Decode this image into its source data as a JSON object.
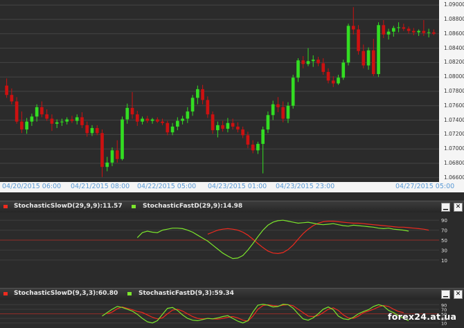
{
  "chart_data": [
    {
      "type": "candlestick",
      "bullish_color": "#33dd22",
      "bearish_color": "#cc1111",
      "ylim": [
        1.0655,
        1.0905
      ],
      "y_ticks": [
        "1.09000",
        "1.08800",
        "1.08600",
        "1.08400",
        "1.08200",
        "1.08000",
        "1.07800",
        "1.07600",
        "1.07400",
        "1.07200",
        "1.07000",
        "1.06800",
        "1.06600"
      ],
      "x_labels": [
        "04/20/2015 06:00",
        "04/21/2015 08:00",
        "04/22/2015 05:00",
        "04/23/2015 01:00",
        "04/23/2015 23:00",
        "04/27/2015 05:00"
      ],
      "ohlc": [
        [
          1.0788,
          1.0798,
          1.0771,
          1.0775
        ],
        [
          1.0775,
          1.0784,
          1.0762,
          1.0766
        ],
        [
          1.0766,
          1.0772,
          1.0735,
          1.0738
        ],
        [
          1.0738,
          1.0752,
          1.0722,
          1.0727
        ],
        [
          1.0727,
          1.0743,
          1.0721,
          1.0738
        ],
        [
          1.0738,
          1.0749,
          1.0732,
          1.0745
        ],
        [
          1.0745,
          1.0762,
          1.0738,
          1.0758
        ],
        [
          1.0758,
          1.0766,
          1.0744,
          1.0748
        ],
        [
          1.0748,
          1.0755,
          1.0739,
          1.0742
        ],
        [
          1.0742,
          1.0748,
          1.0725,
          1.0735
        ],
        [
          1.0735,
          1.0741,
          1.0729,
          1.0737
        ],
        [
          1.0737,
          1.0742,
          1.0732,
          1.0738
        ],
        [
          1.0738,
          1.0744,
          1.0734,
          1.0741
        ],
        [
          1.0741,
          1.0746,
          1.0736,
          1.0739
        ],
        [
          1.0739,
          1.0748,
          1.0734,
          1.0744
        ],
        [
          1.0744,
          1.0751,
          1.0729,
          1.0733
        ],
        [
          1.0733,
          1.0738,
          1.0717,
          1.0722
        ],
        [
          1.0722,
          1.0733,
          1.0718,
          1.0729
        ],
        [
          1.0729,
          1.0733,
          1.0719,
          1.0722
        ],
        [
          1.0722,
          1.0727,
          1.0661,
          1.0675
        ],
        [
          1.0675,
          1.0689,
          1.0669,
          1.0681
        ],
        [
          1.0681,
          1.0702,
          1.0676,
          1.0698
        ],
        [
          1.0698,
          1.0712,
          1.0681,
          1.0686
        ],
        [
          1.0686,
          1.0745,
          1.0684,
          1.0741
        ],
        [
          1.0741,
          1.0763,
          1.0735,
          1.0757
        ],
        [
          1.0757,
          1.0779,
          1.0742,
          1.0748
        ],
        [
          1.0748,
          1.0753,
          1.0732,
          1.0738
        ],
        [
          1.0738,
          1.0745,
          1.0734,
          1.0742
        ],
        [
          1.0742,
          1.0746,
          1.0736,
          1.0739
        ],
        [
          1.0739,
          1.0743,
          1.0735,
          1.0741
        ],
        [
          1.0741,
          1.0744,
          1.0736,
          1.0738
        ],
        [
          1.0738,
          1.0742,
          1.0733,
          1.0736
        ],
        [
          1.0736,
          1.0739,
          1.0719,
          1.0723
        ],
        [
          1.0723,
          1.0736,
          1.0719,
          1.0731
        ],
        [
          1.0731,
          1.0744,
          1.0726,
          1.0739
        ],
        [
          1.0739,
          1.0746,
          1.0734,
          1.0742
        ],
        [
          1.0742,
          1.0758,
          1.0736,
          1.0752
        ],
        [
          1.0752,
          1.0775,
          1.0746,
          1.0771
        ],
        [
          1.0771,
          1.0788,
          1.0762,
          1.0783
        ],
        [
          1.0783,
          1.0789,
          1.0762,
          1.0768
        ],
        [
          1.0768,
          1.0773,
          1.0743,
          1.0748
        ],
        [
          1.0748,
          1.0752,
          1.0721,
          1.0726
        ],
        [
          1.0726,
          1.0738,
          1.0716,
          1.0733
        ],
        [
          1.0733,
          1.0739,
          1.0724,
          1.0728
        ],
        [
          1.0728,
          1.0743,
          1.0723,
          1.0736
        ],
        [
          1.0736,
          1.0742,
          1.0727,
          1.0731
        ],
        [
          1.0731,
          1.0737,
          1.0723,
          1.0727
        ],
        [
          1.0727,
          1.0731,
          1.0715,
          1.0719
        ],
        [
          1.0719,
          1.0724,
          1.0701,
          1.0706
        ],
        [
          1.0706,
          1.0712,
          1.0694,
          1.0698
        ],
        [
          1.0698,
          1.071,
          1.0693,
          1.0707
        ],
        [
          1.0707,
          1.0731,
          1.0666,
          1.0727
        ],
        [
          1.0727,
          1.0752,
          1.0722,
          1.0747
        ],
        [
          1.0747,
          1.0767,
          1.074,
          1.0762
        ],
        [
          1.0762,
          1.0772,
          1.0751,
          1.0758
        ],
        [
          1.0758,
          1.0766,
          1.0737,
          1.0742
        ],
        [
          1.0742,
          1.0765,
          1.0736,
          1.076
        ],
        [
          1.076,
          1.0803,
          1.0756,
          1.0799
        ],
        [
          1.0799,
          1.0826,
          1.0793,
          1.0823
        ],
        [
          1.0823,
          1.0829,
          1.0812,
          1.0818
        ],
        [
          1.0818,
          1.084,
          1.0815,
          1.0822
        ],
        [
          1.0822,
          1.083,
          1.0814,
          1.0824
        ],
        [
          1.0824,
          1.0828,
          1.0815,
          1.0819
        ],
        [
          1.0819,
          1.0826,
          1.0803,
          1.0807
        ],
        [
          1.0807,
          1.0812,
          1.0791,
          1.0795
        ],
        [
          1.0795,
          1.0801,
          1.0786,
          1.0791
        ],
        [
          1.0791,
          1.0803,
          1.0789,
          1.0799
        ],
        [
          1.0799,
          1.0824,
          1.0796,
          1.082
        ],
        [
          1.082,
          1.0874,
          1.0816,
          1.0871
        ],
        [
          1.0871,
          1.0897,
          1.0859,
          1.0866
        ],
        [
          1.0866,
          1.0872,
          1.0831,
          1.0836
        ],
        [
          1.0836,
          1.0845,
          1.0812,
          1.0816
        ],
        [
          1.0816,
          1.0841,
          1.081,
          1.0837
        ],
        [
          1.0837,
          1.0853,
          1.0801,
          1.0804
        ],
        [
          1.0804,
          1.0876,
          1.08,
          1.0872
        ],
        [
          1.0872,
          1.0879,
          1.0854,
          1.0859
        ],
        [
          1.0859,
          1.0867,
          1.0852,
          1.0863
        ],
        [
          1.0863,
          1.0871,
          1.0856,
          1.0868
        ],
        [
          1.0868,
          1.0876,
          1.0862,
          1.0869
        ],
        [
          1.0869,
          1.0874,
          1.0864,
          1.0867
        ],
        [
          1.0867,
          1.087,
          1.086,
          1.0864
        ],
        [
          1.0864,
          1.0868,
          1.0858,
          1.0862
        ],
        [
          1.0862,
          1.0866,
          1.0857,
          1.0864
        ],
        [
          1.0864,
          1.0879,
          1.0857,
          1.0861
        ],
        [
          1.0861,
          1.0867,
          1.0855,
          1.0862
        ],
        [
          1.0862,
          1.0866,
          1.0858,
          1.086
        ]
      ]
    },
    {
      "type": "line",
      "title": "StochasticSlowD(29,9,9):11.57 / StochasticFastD(29,9):14.98",
      "y_ticks": [
        "90",
        "70",
        "50",
        "30",
        "10"
      ],
      "ylim": [
        0,
        100
      ],
      "reference_level": 50,
      "series": [
        {
          "name": "StochasticSlowD(29,9,9):11.57",
          "color": "#ee2a1e",
          "values": [
            null,
            null,
            null,
            null,
            null,
            null,
            null,
            null,
            null,
            null,
            null,
            null,
            null,
            null,
            null,
            null,
            null,
            null,
            null,
            null,
            null,
            null,
            null,
            null,
            null,
            null,
            null,
            null,
            null,
            null,
            null,
            null,
            null,
            null,
            null,
            null,
            null,
            null,
            null,
            null,
            62,
            66,
            70,
            72,
            73,
            72,
            70,
            66,
            60,
            52,
            43,
            35,
            28,
            24,
            23,
            25,
            31,
            40,
            52,
            63,
            72,
            79,
            84,
            87,
            88,
            88,
            87,
            86,
            85,
            84,
            84,
            83,
            82,
            81,
            80,
            79,
            78,
            77,
            76,
            76,
            75,
            74,
            73,
            72,
            70
          ]
        },
        {
          "name": "StochasticFastD(29,9):14.98",
          "color": "#7ce62c",
          "values": [
            null,
            null,
            null,
            null,
            null,
            null,
            null,
            null,
            null,
            null,
            null,
            null,
            null,
            null,
            null,
            null,
            null,
            null,
            null,
            null,
            null,
            null,
            null,
            null,
            null,
            null,
            55,
            65,
            68,
            66,
            65,
            70,
            72,
            74,
            74,
            73,
            70,
            66,
            60,
            54,
            48,
            40,
            32,
            24,
            18,
            13,
            14,
            19,
            30,
            43,
            57,
            70,
            80,
            86,
            89,
            90,
            88,
            86,
            84,
            85,
            86,
            84,
            82,
            81,
            82,
            83,
            81,
            79,
            78,
            80,
            79,
            78,
            77,
            76,
            74,
            73,
            74,
            72,
            71,
            70,
            68
          ]
        }
      ]
    },
    {
      "type": "line",
      "title": "StochasticSlowD(9,3,3):60.80 / StochasticFastD(9,3):59.34",
      "y_ticks": [
        "90",
        "70",
        "50",
        "30",
        "10"
      ],
      "ylim": [
        0,
        100
      ],
      "reference_level": 50,
      "series": [
        {
          "name": "StochasticSlowD(9,3,3):60.80",
          "color": "#ee2a1e",
          "values": [
            null,
            null,
            null,
            null,
            null,
            null,
            null,
            null,
            null,
            null,
            null,
            null,
            null,
            null,
            null,
            null,
            null,
            null,
            null,
            null,
            50,
            58,
            72,
            80,
            74,
            68,
            60,
            56,
            45,
            35,
            28,
            32,
            50,
            66,
            70,
            62,
            50,
            38,
            30,
            28,
            30,
            28,
            27,
            30,
            35,
            38,
            32,
            22,
            18,
            40,
            70,
            86,
            90,
            86,
            84,
            88,
            90,
            85,
            70,
            55,
            40,
            38,
            42,
            55,
            70,
            76,
            65,
            45,
            32,
            30,
            40,
            55,
            62,
            70,
            80,
            86,
            82,
            70,
            60,
            55
          ]
        },
        {
          "name": "StochasticFastD(9,3):59.34",
          "color": "#7ce62c",
          "values": [
            null,
            null,
            null,
            null,
            null,
            null,
            null,
            null,
            null,
            null,
            null,
            null,
            null,
            null,
            null,
            null,
            null,
            null,
            null,
            40,
            55,
            70,
            82,
            78,
            70,
            62,
            48,
            30,
            15,
            10,
            20,
            48,
            74,
            78,
            65,
            45,
            30,
            22,
            20,
            25,
            30,
            28,
            32,
            38,
            42,
            30,
            18,
            10,
            20,
            58,
            88,
            92,
            88,
            80,
            82,
            92,
            90,
            75,
            50,
            28,
            22,
            32,
            50,
            70,
            80,
            68,
            40,
            28,
            25,
            35,
            50,
            60,
            68,
            82,
            90,
            84,
            65,
            55,
            42,
            30,
            20
          ]
        }
      ]
    }
  ],
  "main": {
    "price_labels": [
      "1.09000",
      "1.08800",
      "1.08600",
      "1.08400",
      "1.08200",
      "1.08000",
      "1.07800",
      "1.07600",
      "1.07400",
      "1.07200",
      "1.07000",
      "1.06800",
      "1.06600"
    ],
    "date_labels": [
      "04/20/2015 06:00",
      "04/21/2015 08:00",
      "04/22/2015 05:00",
      "04/23/2015 01:00",
      "04/23/2015 23:00",
      "04/27/2015 05:00"
    ]
  },
  "panel1": {
    "legend_slow": "StochasticSlowD(29,9,9):11.57",
    "legend_fast": "StochasticFastD(29,9):14.98",
    "minimize_glyph": "▁",
    "close_glyph": "✕"
  },
  "panel2": {
    "legend_slow": "StochasticSlowD(9,3,3):60.80",
    "legend_fast": "StochasticFastD(9,3):59.34",
    "minimize_glyph": "▁",
    "close_glyph": "✕"
  },
  "watermark": "forex24.at.ua",
  "colors": {
    "up": "#33dd22",
    "down": "#cc1111",
    "slow": "#ee2a1e",
    "fast": "#7ce62c",
    "grid": "#454545"
  }
}
